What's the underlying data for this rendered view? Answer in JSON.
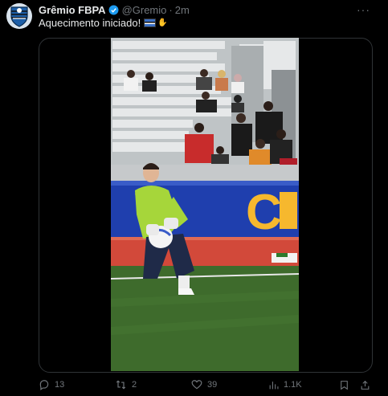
{
  "post": {
    "author_name": "Grêmio FBPA",
    "handle": "@Gremio",
    "separator": "·",
    "time": "2m",
    "text": "Aquecimento iniciado!",
    "more_label": "···"
  },
  "video": {
    "banner_text": "C",
    "colors": {
      "banner_blue": "#1f3fae",
      "banner_yellow": "#f6b82e",
      "pitch": "#3e6b2c",
      "track": "#d2493a",
      "jersey": "#a6d63a"
    }
  },
  "actions": {
    "replies": "13",
    "reposts": "2",
    "likes": "39",
    "views": "1.1K"
  },
  "colors": {
    "background": "#000000",
    "text": "#e7e9ea",
    "muted": "#71767b",
    "verified": "#1d9bf0",
    "border": "#2f3336"
  }
}
